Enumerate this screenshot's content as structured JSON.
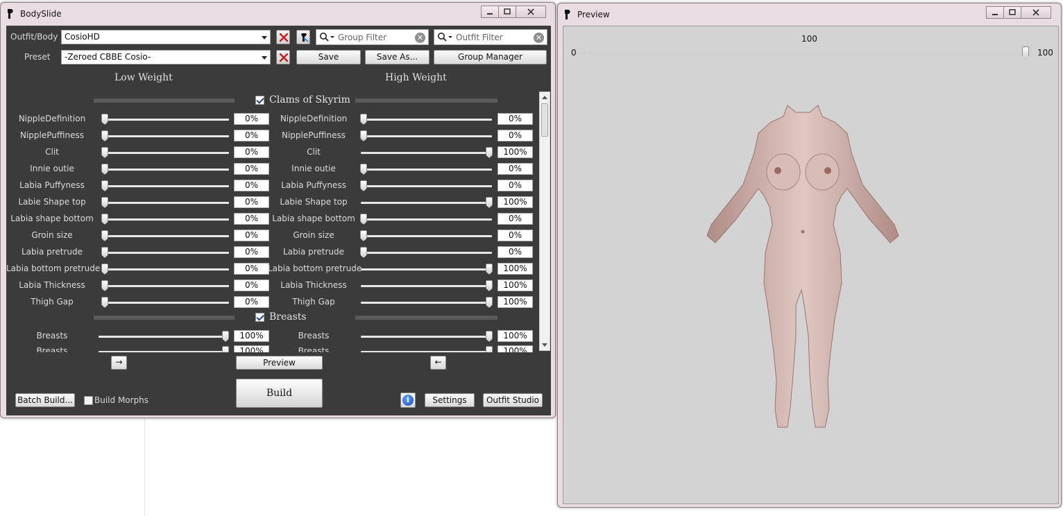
{
  "bodyslide": {
    "title": "BodySlide",
    "outfit_label": "Outfit/Body",
    "outfit_value": "CosioHD",
    "preset_label": "Preset",
    "preset_value": "-Zeroed CBBE Cosio-",
    "group_filter_placeholder": "Group Filter",
    "outfit_filter_placeholder": "Outfit Filter",
    "save_label": "Save",
    "save_as_label": "Save As...",
    "group_manager_label": "Group Manager",
    "low_weight_label": "Low Weight",
    "high_weight_label": "High Weight",
    "groups": [
      {
        "name": "Clams of Skyrim",
        "checked": true
      },
      {
        "name": "Breasts",
        "checked": true
      }
    ],
    "sliders": [
      {
        "name": "NippleDefinition",
        "low": "0%",
        "high": "0%"
      },
      {
        "name": "NipplePuffiness",
        "low": "0%",
        "high": "0%"
      },
      {
        "name": "Clit",
        "low": "0%",
        "high": "100%"
      },
      {
        "name": "Innie outie",
        "low": "0%",
        "high": "0%"
      },
      {
        "name": "Labia Puffyness",
        "low": "0%",
        "high": "0%"
      },
      {
        "name": "Labie Shape top",
        "low": "0%",
        "high": "100%"
      },
      {
        "name": "Labia shape bottom",
        "low": "0%",
        "high": "0%"
      },
      {
        "name": "Groin size",
        "low": "0%",
        "high": "0%"
      },
      {
        "name": "Labia pretrude",
        "low": "0%",
        "high": "0%"
      },
      {
        "name": "Labia bottom pretrude",
        "low": "0%",
        "high": "100%"
      },
      {
        "name": "Labia Thickness",
        "low": "0%",
        "high": "100%"
      },
      {
        "name": "Thigh Gap",
        "low": "0%",
        "high": "100%"
      }
    ],
    "breast_slider": {
      "name": "Breasts",
      "low": "100%",
      "high": "100%"
    },
    "copy_right_label": "→",
    "copy_left_label": "←",
    "preview_label": "Preview",
    "build_label": "Build",
    "batch_build_label": "Batch Build...",
    "build_morphs_label": "Build Morphs",
    "build_morphs_checked": false,
    "settings_label": "Settings",
    "outfit_studio_label": "Outfit Studio"
  },
  "preview": {
    "title": "Preview",
    "weight_value": "100",
    "min_label": "0",
    "max_label": "100"
  },
  "colors": {
    "panel_bg": "#3b3b3b",
    "frame": "#e9dde3",
    "preview_bg": "#d3d3d3",
    "reset_x": "#c81e1e"
  }
}
